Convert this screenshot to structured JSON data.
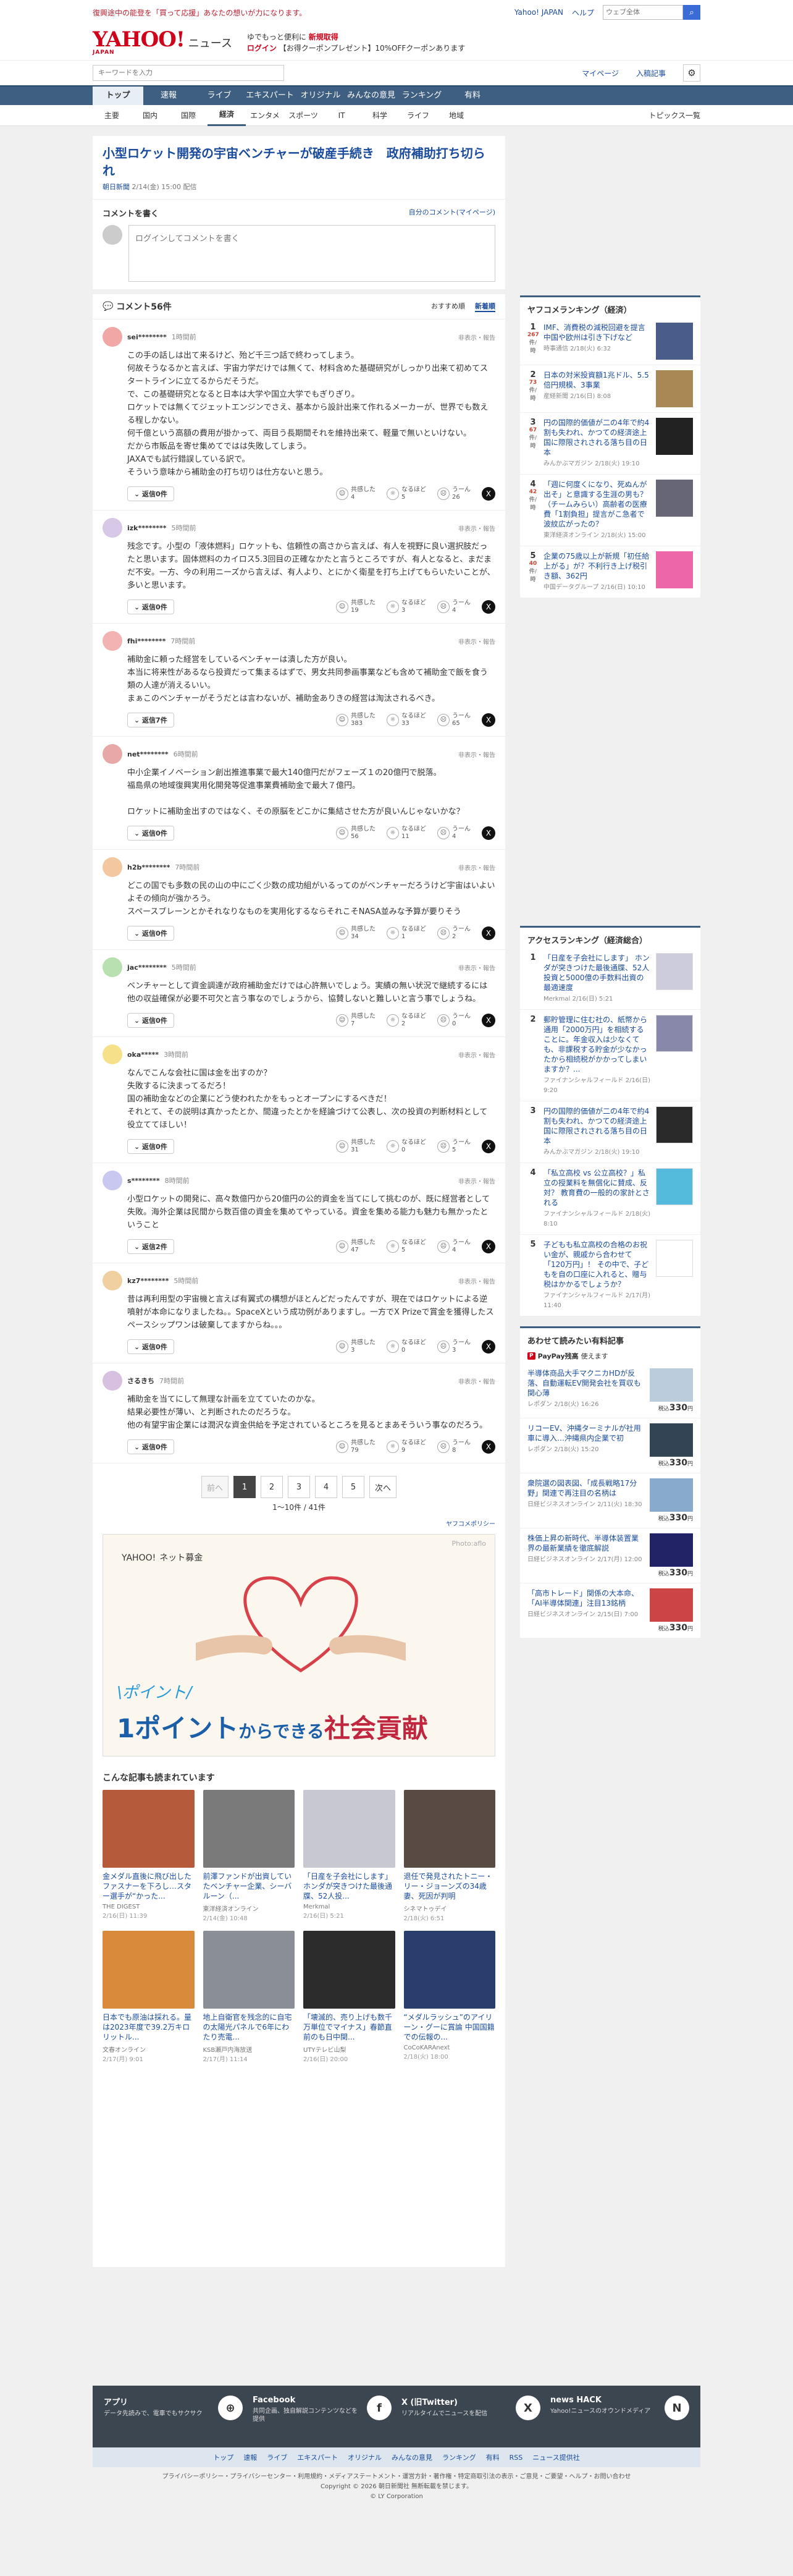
{
  "topstrip": {
    "notice": "復興途中の能登を「買って応援」あなたの想いが力になります。",
    "links": [
      "Yahoo! JAPAN",
      "ヘルプ"
    ],
    "search_placeholder": "ウェブ全体",
    "search_button": "検索"
  },
  "header": {
    "logo": "YAHOO!",
    "logo_sub": "JAPAN",
    "brand": "ニュース",
    "promo_line1": "ゆでもっと便利に",
    "promo_line1b": "新規取得",
    "promo_line2": "ログイン",
    "promo_line2b": "【お得クーポンプレゼント】10%OFFクーポンあります"
  },
  "subhead": {
    "search_placeholder": "キーワードを入力",
    "links": [
      "マイページ",
      "入稿記事"
    ]
  },
  "nav1": [
    "トップ",
    "速報",
    "ライブ",
    "エキスパート",
    "オリジナル",
    "みんなの意見",
    "ランキング",
    "有料"
  ],
  "nav2": [
    "主要",
    "国内",
    "国際",
    "経済",
    "エンタメ",
    "スポーツ",
    "IT",
    "科学",
    "ライフ",
    "地域"
  ],
  "nav2_active": "経済",
  "nav2_topics": "トピックス一覧",
  "article": {
    "title": "小型ロケット開発の宇宙ベンチャーが破産手続き　政府補助打ち切られ",
    "source": "朝日新聞",
    "date": "2/14(金) 15:00 配信"
  },
  "commentbox": {
    "title": "コメントを書く",
    "mycomments": "自分のコメント(マイページ)",
    "placeholder": "ログインしてコメントを書く"
  },
  "comments_header": {
    "title": "コメント56件",
    "sort_recommended": "おすすめ順",
    "sort_new": "新着順"
  },
  "reply_label": "返信0件",
  "react_labels": {
    "agree": "共感した",
    "think": "なるほど",
    "hmm": "うーん"
  },
  "report_label": "非表示・報告",
  "comments": [
    {
      "user": "sei********",
      "time": "1時間前",
      "body": "この手の話しは出て来るけど、殆ど千三つ話で終わってしまう。\n何故そうなるかと言えば、宇宙力学だけでは無くて、材料含めた基礎研究がしっかり出来て初めてスタートラインに立てるからだそうだ。\nで、この基礎研究となると日本は大学や国立大学でもぎりぎり。\nロケットでは無くてジェットエンジンでさえ、基本から設計出来て作れるメーカーが、世界でも数える程しかない。\n何千億という高額の費用が掛かって、両目う長期間それを維持出来て、軽量で無いといけない。\nだから市販品を寄せ集めてではは失敗してしまう。\nJAXAでも試行錯誤している訳で。\nそういう意味から補助金の打ち切りは仕方ないと思う。",
      "agree": "4",
      "think": "5",
      "hmm": "26",
      "reply": "返信0件"
    },
    {
      "user": "izk********",
      "time": "5時間前",
      "body": "残念です。小型の「液体燃料」ロケットも、信頼性の高さから言えば、有人を視野に良い選択肢だったと思います。固体燃料のカイロス5.3回目の正確なかたと言うところですが、有人となると、まだまだ不安。一方、今の利用ニーズから言えば、有人より、とにかく衛星を打ち上げてもらいたいことが、多いと思います。",
      "agree": "19",
      "think": "3",
      "hmm": "4",
      "reply": "返信0件"
    },
    {
      "user": "fhi********",
      "time": "7時間前",
      "body": "補助金に頼った経営をしているベンチャーは潰した方が良い。\n本当に将来性があるなら投資だって集まるはずで、男女共同参画事業なども含めて補助金で飯を食う類の人達が消えるいい。\nまぁこのベンチャーがそうだとは言わないが、補助金ありきの経営は淘汰されるべき。",
      "agree": "383",
      "think": "33",
      "hmm": "65",
      "reply": "返信7件"
    },
    {
      "user": "net********",
      "time": "6時間前",
      "body": "中小企業イノベーション創出推進事業で最大140億円だがフェーズ１の20億円で脱落。\n福島県の地域復興実用化開発等促進事業費補助金で最大７億円。\n\nロケットに補助金出すのではなく、その原脳をどこかに集結させた方が良いんじゃないかな？",
      "agree": "56",
      "think": "11",
      "hmm": "4",
      "reply": "返信0件"
    },
    {
      "user": "h2b********",
      "time": "7時間前",
      "body": "どこの国でも多数の民の山の中にごく少数の成功組がいるってのがベンチャーだろうけど宇宙はいよいよその傾向が強かろう。\nスペースブレーンとかそれなりなものを実用化するならそれこそNASA並みな予算が要りそう",
      "agree": "34",
      "think": "1",
      "hmm": "2",
      "reply": "返信0件"
    },
    {
      "user": "jac********",
      "time": "5時間前",
      "body": "ベンチャーとして資金調達が政府補助金だけでは心許無いでしょう。実績の無い状況で継続するには他の収益確保が必要不可欠と言う事なのでしょうから、協賛しないと難しいと言う事でしょうね。",
      "agree": "7",
      "think": "2",
      "hmm": "0",
      "reply": "返信0件"
    },
    {
      "user": "oka*****",
      "time": "3時間前",
      "body": "なんでこんな会社に国は金を出すのか？\n失敗するに決まってるだろ！\n国の補助金などの企業にどう使われたかをもっとオープンにするべきだ！\nそれとて、その説明は真かったとか、間違ったとかを経論づけて公表し、次の投資の判断材料として役立ててほしい！",
      "agree": "31",
      "think": "0",
      "hmm": "5",
      "reply": "返信0件"
    },
    {
      "user": "s********",
      "time": "8時間前",
      "body": "小型ロケットの開発に、高々数億円から20億円の公的資金を当てにして挑むのが、既に経営者として失敗。海外企業は民間から数百億の資金を集めてやっている。資金を集める能力も魅力も無かったということ",
      "agree": "47",
      "think": "5",
      "hmm": "4",
      "reply": "返信2件"
    },
    {
      "user": "kz7********",
      "time": "5時間前",
      "body": "昔は再利用型の宇宙機と言えば有翼式の構想がほとんどだったんですが、現在ではロケットによる逆噴射が本命になりましたね。。SpaceXという成功例がありますし。一方でX Prizeで賞金を獲得したスペースシップワンは破棄してますからね。。。",
      "agree": "3",
      "think": "0",
      "hmm": "3",
      "reply": "返信0件"
    },
    {
      "user": "さるきち",
      "time": "7時間前",
      "body": "補助金を当てにして無理な計画を立てていたのかな。\n結果必要性が薄い、と判断されたのだろうな。\n他の有望宇宙企業には潤沢な資金供給を予定されているところを見るとまあそういう事なのだろう。",
      "agree": "79",
      "think": "9",
      "hmm": "8",
      "reply": "返信0件"
    }
  ],
  "pager": {
    "prev": "前へ",
    "pages": [
      "1",
      "2",
      "3",
      "4",
      "5"
    ],
    "next": "次へ",
    "count": "1〜10件 / 41件"
  },
  "policy": "ヤフコメポリシー",
  "ad": {
    "logo": "YAHOO!",
    "logo_sub": "ネット募金",
    "photo": "Photo:aflo",
    "line1": "\\ポイント/",
    "line2a": "1ポイント",
    "line2b": "からできる",
    "line2c": "社会貢献"
  },
  "related_title": "こんな記事も読まれています",
  "related": [
    {
      "title": "金メダル直後に飛び出したファスナーを下ろし…スター選手が“かった...",
      "src": "THE DIGEST",
      "date": "2/16(日) 11:39",
      "color": "#b55a3a"
    },
    {
      "title": "前澤ファンドが出資していたベンチャー企業、シーバルーン（...",
      "src": "東洋経済オンライン",
      "date": "2/14(金) 10:48",
      "color": "#7a7a7a"
    },
    {
      "title": "「日産を子会社にします」 ホンダが突きつけた最後通牒、52人投...",
      "src": "Merkmal",
      "date": "2/16(日) 5:21",
      "color": "#c8c8d2"
    },
    {
      "title": "退任で発見されたトニー・リー・ジョーンズの34歳妻、死因が判明",
      "src": "シネマトゥデイ",
      "date": "2/18(火) 6:51",
      "color": "#5a4a44"
    },
    {
      "title": "日本でも原油は採れる。量は2023年度で39.2万キロリットル...",
      "src": "文春オンライン",
      "date": "2/17(月) 9:01",
      "color": "#d98a3a"
    },
    {
      "title": "地上自衛官を残念的に自宅の太陽光パネルで6年にわたり売電...",
      "src": "KSB瀬戸内海放送",
      "date": "2/17(月) 11:14",
      "color": "#8a8f96"
    },
    {
      "title": "「壊滅的、売り上げも数千万単位でマイナス」春節直前のも日中関...",
      "src": "UTYテレビ山梨",
      "date": "2/16(日) 20:00",
      "color": "#2c2c2c"
    },
    {
      "title": "“メダルラッシュ”のアイリーン・グーに賞論 中国国籍での伝報の...",
      "src": "CoCoKARAnext",
      "date": "2/18(火) 18:00",
      "color": "#2a3e6e"
    }
  ],
  "ranking1": {
    "title": "ヤフコメランキング（経済）",
    "unit": "件/時",
    "items": [
      {
        "num": "1",
        "cnt": "267",
        "title": "IMF、消費税の減税回避を提言 中国や欧州は引き下げなど",
        "src": "時事通信",
        "date": "2/18(火) 6:32",
        "color": "#4a5d8a"
      },
      {
        "num": "2",
        "cnt": "73",
        "title": "日本の対米投資額1兆ドル、5.5倍円規模、3事業",
        "src": "産経新聞",
        "date": "2/16(日) 8:08",
        "color": "#a85"
      },
      {
        "num": "3",
        "cnt": "67",
        "title": "円の国際的価値が二の4年で約4割も失われ、かつての経済途上国に際限されされる落ち目の日本",
        "src": "みんかぶマガジン",
        "date": "2/18(火) 19:10",
        "color": "#222"
      },
      {
        "num": "4",
        "cnt": "42",
        "title": "「週に何度くになり、死ぬんが出そ」と意識する生涯の男も？（チームみらい）高齢者の医療費「1割負担」提言がこ急者で波紋広がったの？",
        "src": "東洋経済オンライン",
        "date": "2/18(火) 15:00",
        "color": "#667"
      },
      {
        "num": "5",
        "cnt": "40",
        "title": "企業の75歳以上が新規「初任給上がる」が？不利行き上げ税引き額、362円",
        "src": "中国データグループ",
        "date": "2/16(日) 10:10",
        "color": "#e6a"
      }
    ]
  },
  "ranking2": {
    "title": "アクセスランキング（経済総合）",
    "items": [
      {
        "num": "1",
        "title": "「日産を子会社にします」 ホンダが突きつけた最後通牒、52人投資と5000億の手数料出資の最適速度",
        "src": "Merkmal",
        "date": "2/16(日) 5:21",
        "color": "#ccd"
      },
      {
        "num": "2",
        "title": "郵貯管理に住む社の、紙幣から通用「2000万円」を相続することに。年金収入は少なくても、非課税する貯金が少なかったから相続税がかかってしまいますか？...",
        "src": "ファイナンシャルフィールド",
        "date": "2/16(日) 9:20",
        "color": "#88a"
      },
      {
        "num": "3",
        "title": "円の国際的価値が二の4年で約4割も失われ、かつての経済途上国に際限されされる落ち目の日本",
        "src": "みんかぶマガジン",
        "date": "2/18(火) 19:10",
        "color": "#2a2a2a"
      },
      {
        "num": "4",
        "title": "「私立高校 vs 公立高校？」私立の授業料を無償化に賛成、反対？ 教育費の一般的の家計とされる",
        "src": "ファイナンシャルフィールド",
        "date": "2/18(火) 8:10",
        "color": "#5bd"
      },
      {
        "num": "5",
        "title": "子どもも私立高校の合格のお祝い金が、親戚から合わせて「120万円」！ その中で、子どもを自の口座に入れると、贈与税はかかるでしょうか？",
        "src": "ファイナンシャルフィールド",
        "date": "2/17(月) 11:40",
        "color": "#fff"
      }
    ]
  },
  "paid": {
    "title": "あわせて読みたい有料記事",
    "paypay": "PayPay残高",
    "paypay_sub": "使えます",
    "items": [
      {
        "title": "半導体商品大手マクニカHDが反落、自動運転EV開発会社を買収も関心薄",
        "src": "レポダン",
        "date": "2/18(火) 16:26",
        "price": "330",
        "color": "#bcd"
      },
      {
        "title": "リコーEV、沖縄ターミナルが社用車に導入…沖縄県内企業で初",
        "src": "レポダン",
        "date": "2/18(火) 15:20",
        "price": "330",
        "color": "#345"
      },
      {
        "title": "衆院選の図表図、「成長戦略17分野」関連で再注目の名柄は",
        "src": "日経ビジネスオンライン",
        "date": "2/11(火) 18:30",
        "price": "330",
        "color": "#8ac"
      },
      {
        "title": "株価上昇の新時代、半導体装置業界の最新業績を徹底解説",
        "src": "日経ビジネスオンライン",
        "date": "2/17(月) 12:00",
        "price": "330",
        "color": "#226"
      },
      {
        "title": "「高市トレード」関係の大本命、「AI半導体関連」注目13銘柄",
        "src": "日経ビジネスオンライン",
        "date": "2/15(日) 7:00",
        "price": "330",
        "color": "#c44"
      }
    ],
    "yen": "円",
    "tax": "税込"
  },
  "footer": {
    "apps": [
      {
        "title": "アプリ",
        "desc": "データ先読みで、電車でもサクサク",
        "icon": "⊕"
      },
      {
        "title": "Facebook",
        "desc": "共同企画、独自解説コンテンツなどを提供",
        "icon": "f"
      },
      {
        "title": "X (旧Twitter)",
        "desc": "リアルタイムでニュースを配信",
        "icon": "X"
      },
      {
        "title": "news HACK",
        "desc": "Yahoo!ニュースのオウンドメディア",
        "icon": "N"
      }
    ],
    "nav": [
      "トップ",
      "速報",
      "ライブ",
      "エキスパート",
      "オリジナル",
      "みんなの意見",
      "ランキング",
      "有料",
      "RSS",
      "ニュース提供社"
    ],
    "links": "プライバシーポリシー・プライバシーセンター・利用規約・メディアステートメント・運営方針・著作権・特定商取引法の表示・ご意見・ご要望・ヘルプ・お問い合わせ",
    "copy1": "Copyright © 2026 朝日新聞社 無断転載を禁じます。",
    "copy2": "© LY Corporation"
  },
  "colors": {
    "accent": "#1a4b9c",
    "nav": "#3f5f82",
    "brand": "#d0021b"
  }
}
